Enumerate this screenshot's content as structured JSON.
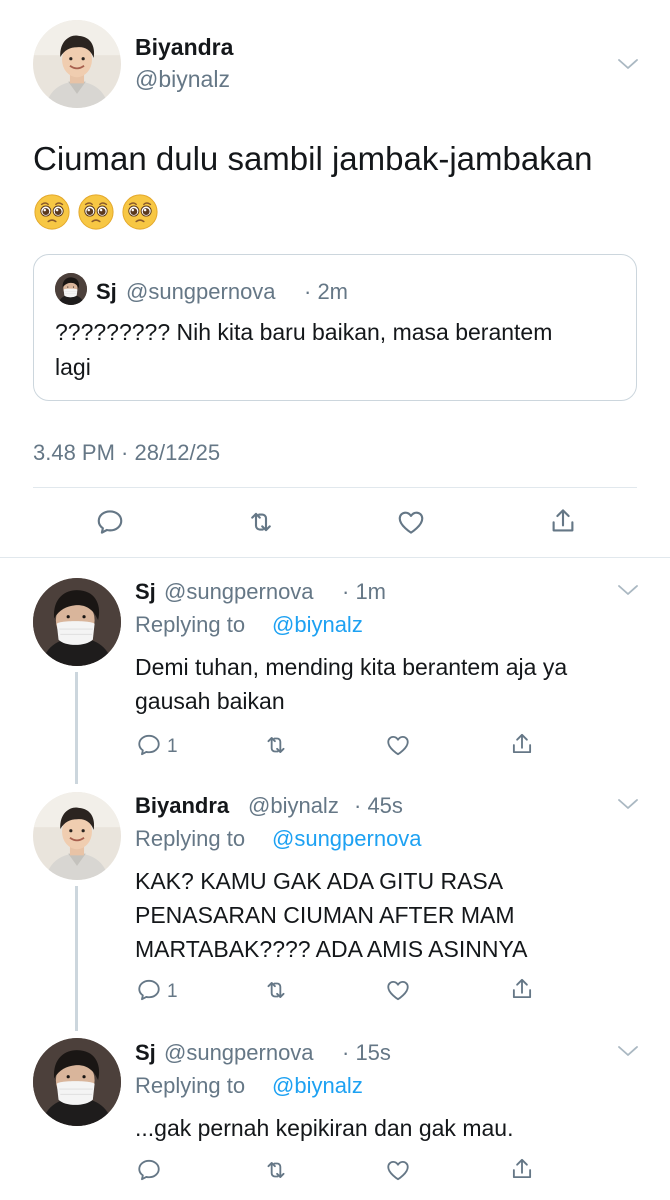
{
  "main_tweet": {
    "author_name": "Biyandra",
    "author_handle": "@biynalz",
    "text": "Ciuman dulu sambil jambak-jambakan",
    "emoji": [
      "pleading-face",
      "pleading-face",
      "pleading-face"
    ],
    "quoted": {
      "author_name": "Sj",
      "author_handle": "@sungpernova",
      "time": "· 2m",
      "text_line1": "????????? Nih kita baru baikan, masa berantem",
      "text_line2": "lagi"
    },
    "timestamp": "3.48 PM · 28/12/25"
  },
  "replies": [
    {
      "author_name": "Sj",
      "author_handle": "@sungpernova",
      "time": "· 1m",
      "replying_label": "Replying to",
      "replying_to": "@biynalz",
      "line1": "Demi tuhan, mending kita berantem aja ya",
      "line2": "gausah baikan",
      "line3": "",
      "reply_count": "1"
    },
    {
      "author_name": "Biyandra",
      "author_handle": "@biynalz",
      "time": "· 45s",
      "replying_label": "Replying to",
      "replying_to": "@sungpernova",
      "line1": "KAK? KAMU GAK ADA GITU RASA",
      "line2": "PENASARAN CIUMAN AFTER MAM",
      "line3": "MARTABAK???? ADA AMIS ASINNYA",
      "reply_count": "1"
    },
    {
      "author_name": "Sj",
      "author_handle": "@sungpernova",
      "time": "· 15s",
      "replying_label": "Replying to",
      "replying_to": "@biynalz",
      "line1": "...gak pernah kepikiran dan gak mau.",
      "line2": "",
      "line3": "",
      "reply_count": ""
    }
  ],
  "colors": {
    "accent": "#1da1f2",
    "muted": "#657786",
    "border": "#ccd6dd"
  }
}
